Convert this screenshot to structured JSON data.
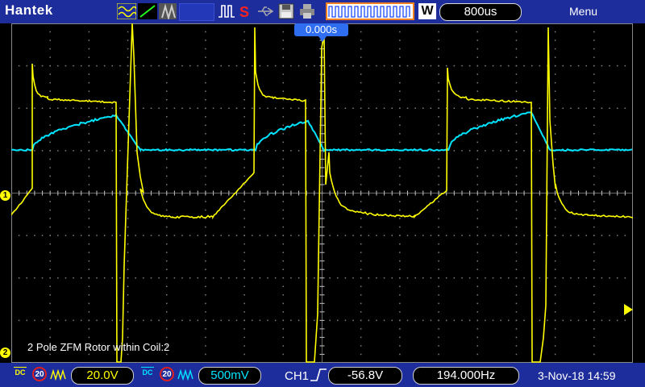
{
  "topbar": {
    "brand": "Hantek",
    "timebase": "800us",
    "waveform_mode_label": "W",
    "menu_label": "Menu"
  },
  "screen": {
    "trigger_time_position": "0.000s",
    "annotation": "2 Pole ZFM Rotor within Coil:2",
    "ch1_marker": "1",
    "ch2_marker": "2",
    "colors": {
      "ch1": "#ffff00",
      "ch2": "#00e5ff",
      "grid": "#808080",
      "background": "#000000"
    }
  },
  "bottombar": {
    "ch1": {
      "coupling": "DC",
      "probe": "20",
      "scale": "20.0V",
      "color": "#ffff00"
    },
    "ch2": {
      "coupling": "DC",
      "probe": "20",
      "scale": "500mV",
      "color": "#00e5ff"
    },
    "trigger": {
      "source": "CH1",
      "level": "-56.8V",
      "edge_icon": "rising-edge-icon"
    },
    "frequency": "194.000Hz",
    "datetime": "3-Nov-18 14:59"
  }
}
